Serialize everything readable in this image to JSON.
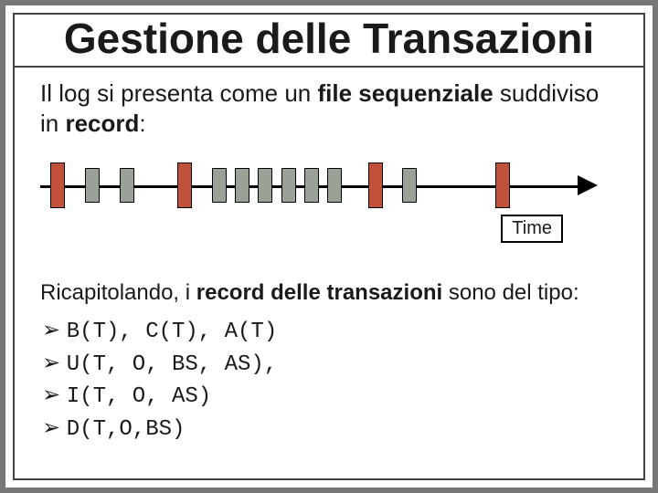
{
  "title": "Gestione delle Transazioni",
  "intro": {
    "pre": "Il log si presenta come un ",
    "bold1": "file sequenziale",
    "mid": " suddiviso in ",
    "bold2": "record",
    "post": ":"
  },
  "timeline": {
    "label": "Time",
    "ticks": [
      {
        "x": 3,
        "kind": "big"
      },
      {
        "x": 9,
        "kind": "small"
      },
      {
        "x": 15,
        "kind": "small"
      },
      {
        "x": 25,
        "kind": "big"
      },
      {
        "x": 31,
        "kind": "small"
      },
      {
        "x": 35,
        "kind": "small"
      },
      {
        "x": 39,
        "kind": "small"
      },
      {
        "x": 43,
        "kind": "small"
      },
      {
        "x": 47,
        "kind": "small"
      },
      {
        "x": 51,
        "kind": "small"
      },
      {
        "x": 58,
        "kind": "big"
      },
      {
        "x": 64,
        "kind": "small"
      },
      {
        "x": 80,
        "kind": "big"
      }
    ]
  },
  "summary": {
    "pre": "Ricapitolando, i ",
    "bold": "record delle transazioni",
    "post": " sono del tipo:"
  },
  "records": [
    "B(T), C(T), A(T)",
    "U(T, O, BS, AS),",
    "I(T, O, AS)",
    "D(T,O,BS)"
  ]
}
